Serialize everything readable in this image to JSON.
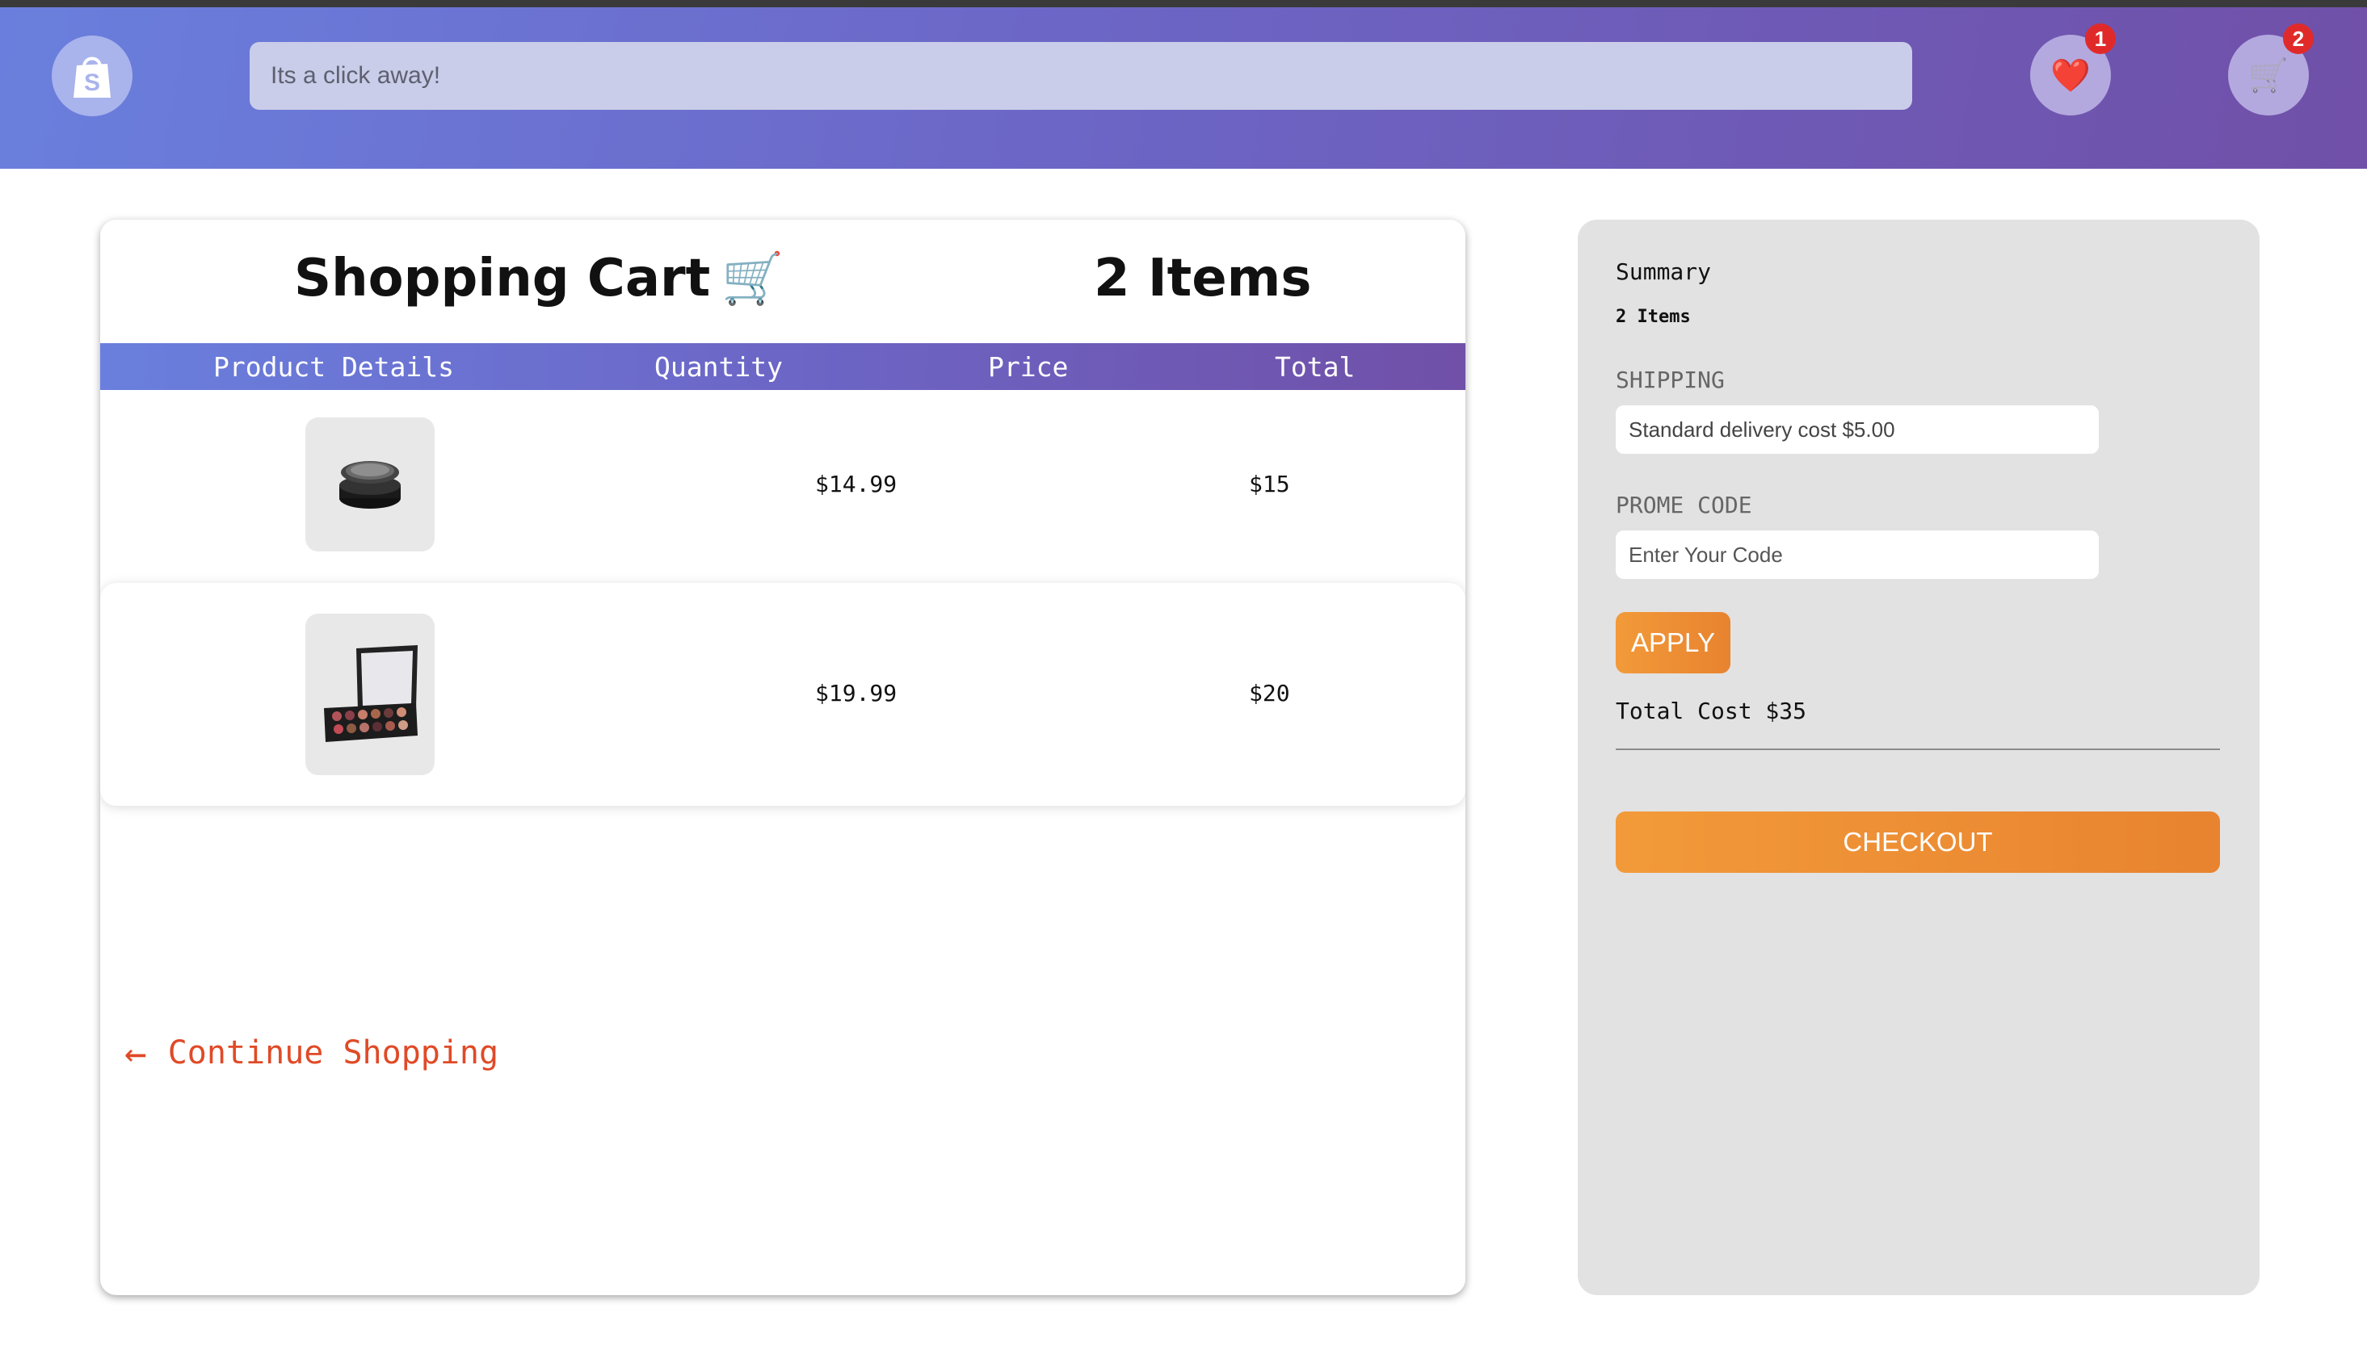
{
  "header": {
    "logo_icon": "shopping-bag-logo-icon",
    "search_placeholder": "Its a click away!",
    "wishlist": {
      "icon": "heart-icon",
      "glyph": "❤️",
      "count": "1"
    },
    "cart": {
      "icon": "cart-icon",
      "glyph": "🛒",
      "count": "2"
    },
    "gradient_start": "#6a7fdd",
    "gradient_end": "#7050a8"
  },
  "cart": {
    "title": "Shopping Cart",
    "title_icon": "🛒",
    "item_count": "2 Items",
    "columns": [
      "Product Details",
      "Quantity",
      "Price",
      "Total"
    ],
    "rows": [
      {
        "product_image": "compact-powder-image",
        "price": "$14.99",
        "total": "$15"
      },
      {
        "product_image": "eyeshadow-palette-image",
        "price": "$19.99",
        "total": "$20"
      }
    ],
    "continue_arrow": "←",
    "continue_label": "Continue Shopping",
    "continue_color": "#e04a27"
  },
  "summary": {
    "title": "Summary",
    "items": "2 Items",
    "shipping_label": "SHIPPING",
    "shipping_value": "Standard delivery cost $5.00",
    "promo_label": "PROME CODE",
    "promo_placeholder": "Enter Your Code",
    "apply_label": "APPLY",
    "total_cost": "Total Cost $35",
    "checkout_label": "CHECKOUT",
    "accent": "#ee913a"
  }
}
